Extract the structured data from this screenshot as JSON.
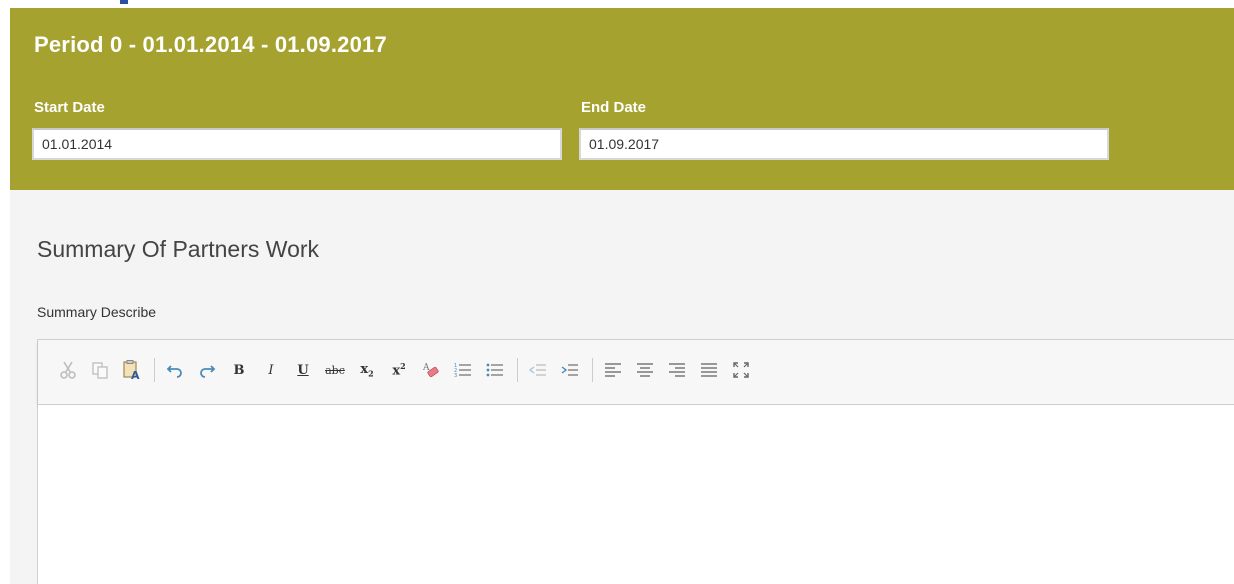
{
  "period": {
    "title": "Period 0 - 01.01.2014 - 01.09.2017",
    "start_label": "Start Date",
    "start_value": "01.01.2014",
    "end_label": "End Date",
    "end_value": "01.09.2017"
  },
  "summary": {
    "heading": "Summary Of Partners Work",
    "field_label": "Summary Describe",
    "body_text": ""
  },
  "toolbar": {
    "buttons": [
      {
        "icon": "cut-icon",
        "enabled": false
      },
      {
        "icon": "copy-icon",
        "enabled": false
      },
      {
        "icon": "paste-text-icon",
        "enabled": true
      },
      {
        "icon": "undo-icon",
        "enabled": true
      },
      {
        "icon": "redo-icon",
        "enabled": true
      },
      {
        "icon": "bold-icon",
        "label": "B"
      },
      {
        "icon": "italic-icon",
        "label": "I"
      },
      {
        "icon": "underline-icon",
        "label": "U"
      },
      {
        "icon": "strikethrough-icon",
        "label": "abc"
      },
      {
        "icon": "subscript-icon",
        "label": "x"
      },
      {
        "icon": "superscript-icon",
        "label": "x"
      },
      {
        "icon": "clear-format-icon"
      },
      {
        "icon": "numbered-list-icon"
      },
      {
        "icon": "bulleted-list-icon"
      },
      {
        "icon": "outdent-icon"
      },
      {
        "icon": "indent-icon"
      },
      {
        "icon": "align-left-icon"
      },
      {
        "icon": "align-center-icon"
      },
      {
        "icon": "align-right-icon"
      },
      {
        "icon": "justify-icon"
      },
      {
        "icon": "maximize-icon"
      }
    ]
  },
  "colors": {
    "panel": "#a5a230",
    "panel_text": "#ffffff",
    "content_bg": "#f4f4f4",
    "heading_text": "#444444"
  }
}
